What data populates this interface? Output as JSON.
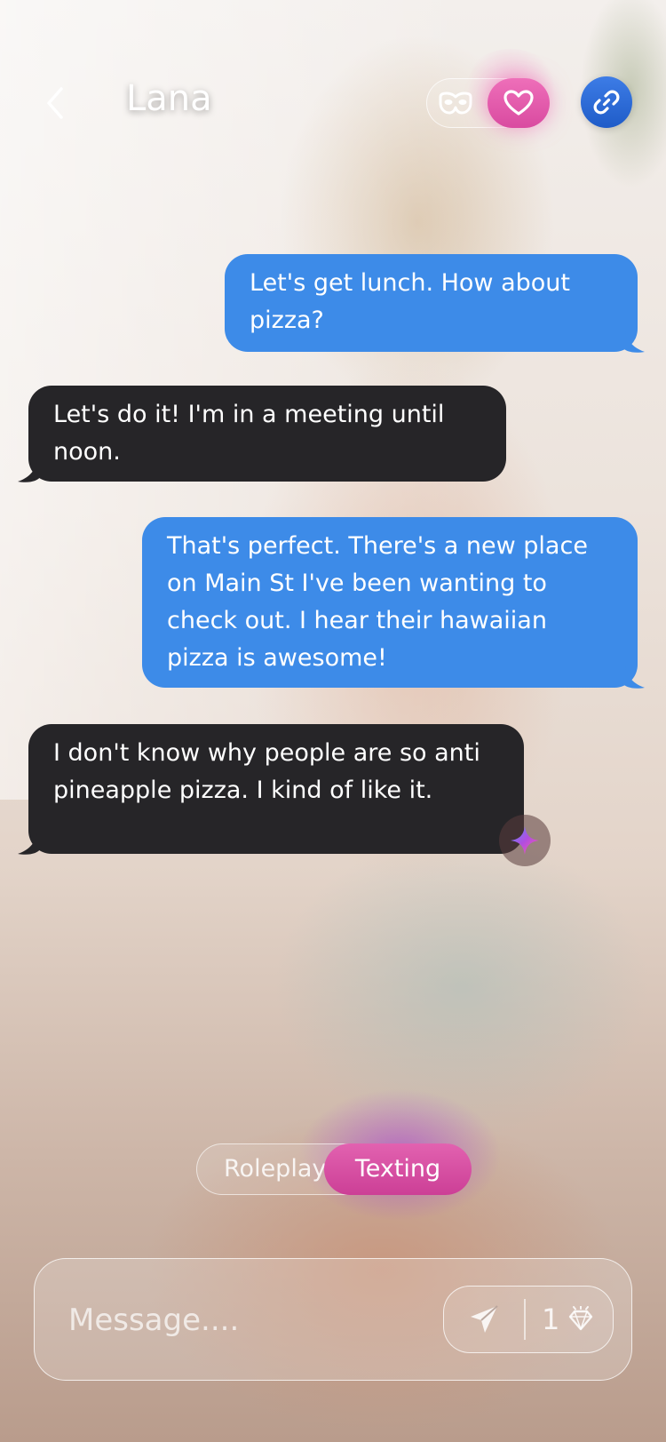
{
  "header": {
    "title": "Lana",
    "back_icon": "chevron-left-icon",
    "mask_icon": "mask-icon",
    "heart_icon": "heart-icon",
    "link_icon": "link-icon"
  },
  "messages": [
    {
      "direction": "outgoing",
      "text": "Let's get lunch. How about pizza?"
    },
    {
      "direction": "incoming",
      "text": "Let's do it! I'm in a meeting until noon."
    },
    {
      "direction": "outgoing",
      "text": "That's perfect. There's a new place on Main St I've been wanting to check out. I hear their hawaiian pizza is awesome!"
    },
    {
      "direction": "incoming",
      "text": "I don't know why people are so anti pineapple pizza. I kind of like it."
    }
  ],
  "mode_toggle": {
    "roleplay_label": "Roleplay",
    "texting_label": "Texting",
    "selected": "Texting"
  },
  "composer": {
    "placeholder": "Message....",
    "value": "",
    "cost": "1",
    "send_icon": "send-icon",
    "gem_icon": "gem-icon"
  },
  "colors": {
    "outgoing_bubble": "#3d8be8",
    "incoming_bubble": "#262528",
    "accent_pink": "#d94aa0",
    "link_blue": "#2f6fd8"
  }
}
